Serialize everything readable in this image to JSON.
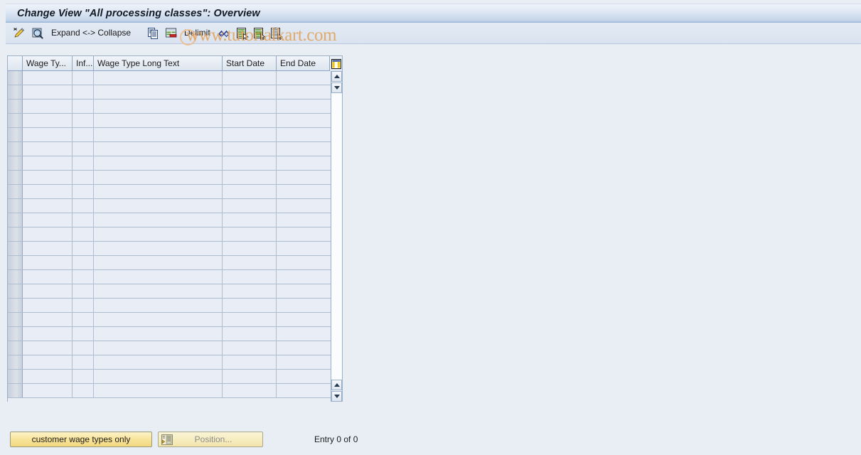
{
  "window": {
    "title": "Change View \"All processing classes\": Overview"
  },
  "watermark": {
    "text": "www.tutorialkart.com",
    "color": "#e2a25a"
  },
  "toolbar": {
    "items": [
      {
        "name": "new-entries-icon",
        "kind": "icon",
        "label": "",
        "tooltip": "New Entries"
      },
      {
        "name": "display-detail-icon",
        "kind": "icon",
        "label": "",
        "tooltip": "Display Detail"
      },
      {
        "name": "expand-collapse",
        "kind": "label",
        "label": "Expand <-> Collapse"
      },
      {
        "name": "copy-as-icon",
        "kind": "icon",
        "label": "",
        "tooltip": "Copy As..."
      },
      {
        "name": "delete-icon",
        "kind": "icon",
        "label": "",
        "tooltip": "Delete"
      },
      {
        "name": "delimit",
        "kind": "label",
        "label": "Delimit"
      },
      {
        "name": "undo-icon",
        "kind": "icon",
        "label": "",
        "tooltip": "Undo Change"
      },
      {
        "name": "select-all-icon",
        "kind": "icon",
        "label": "",
        "tooltip": "Select All"
      },
      {
        "name": "select-block-icon",
        "kind": "icon",
        "label": "",
        "tooltip": "Select Block"
      },
      {
        "name": "deselect-all-icon",
        "kind": "icon",
        "label": "",
        "tooltip": "Deselect All"
      }
    ],
    "expand_collapse_label": "Expand <-> Collapse",
    "delimit_label": "Delimit"
  },
  "table": {
    "columns": [
      {
        "key": "selector",
        "label": ""
      },
      {
        "key": "wage_type",
        "label": "Wage Ty..."
      },
      {
        "key": "infotype",
        "label": "Inf..."
      },
      {
        "key": "long_text",
        "label": "Wage Type Long Text"
      },
      {
        "key": "start_date",
        "label": "Start Date"
      },
      {
        "key": "end_date",
        "label": "End Date"
      }
    ],
    "config_icon": "table-settings-icon",
    "rows": [],
    "empty_row_count": 23
  },
  "footer": {
    "customer_wage_types_button": "customer wage types only",
    "position_button": "Position...",
    "position_button_icon": "position-icon",
    "position_button_enabled": false,
    "entry_status": "Entry 0 of 0"
  }
}
